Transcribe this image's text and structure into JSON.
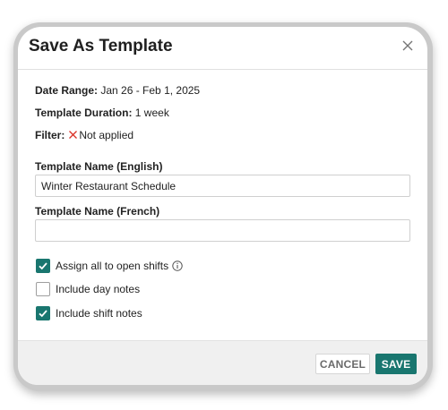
{
  "dialog": {
    "title": "Save As Template",
    "date_range_label": "Date Range:",
    "date_range_value": "Jan 26 - Feb 1, 2025",
    "duration_label": "Template Duration:",
    "duration_value": "1 week",
    "filter_label": "Filter:",
    "filter_value": "Not applied",
    "name_en_label": "Template Name (English)",
    "name_en_value": "Winter Restaurant Schedule",
    "name_fr_label": "Template Name (French)",
    "name_fr_value": "",
    "options": [
      {
        "label": "Assign all to open shifts",
        "checked": true
      },
      {
        "label": "Include day notes",
        "checked": false
      },
      {
        "label": "Include shift notes",
        "checked": true
      }
    ],
    "cancel_label": "CANCEL",
    "save_label": "SAVE"
  },
  "colors": {
    "accent": "#19766f",
    "filter_x": "#d93025",
    "footer_bg": "#f0f0f0"
  },
  "icons": {
    "close": "close-icon",
    "filter": "x-icon",
    "info": "info-icon",
    "check": "checkmark-icon"
  }
}
